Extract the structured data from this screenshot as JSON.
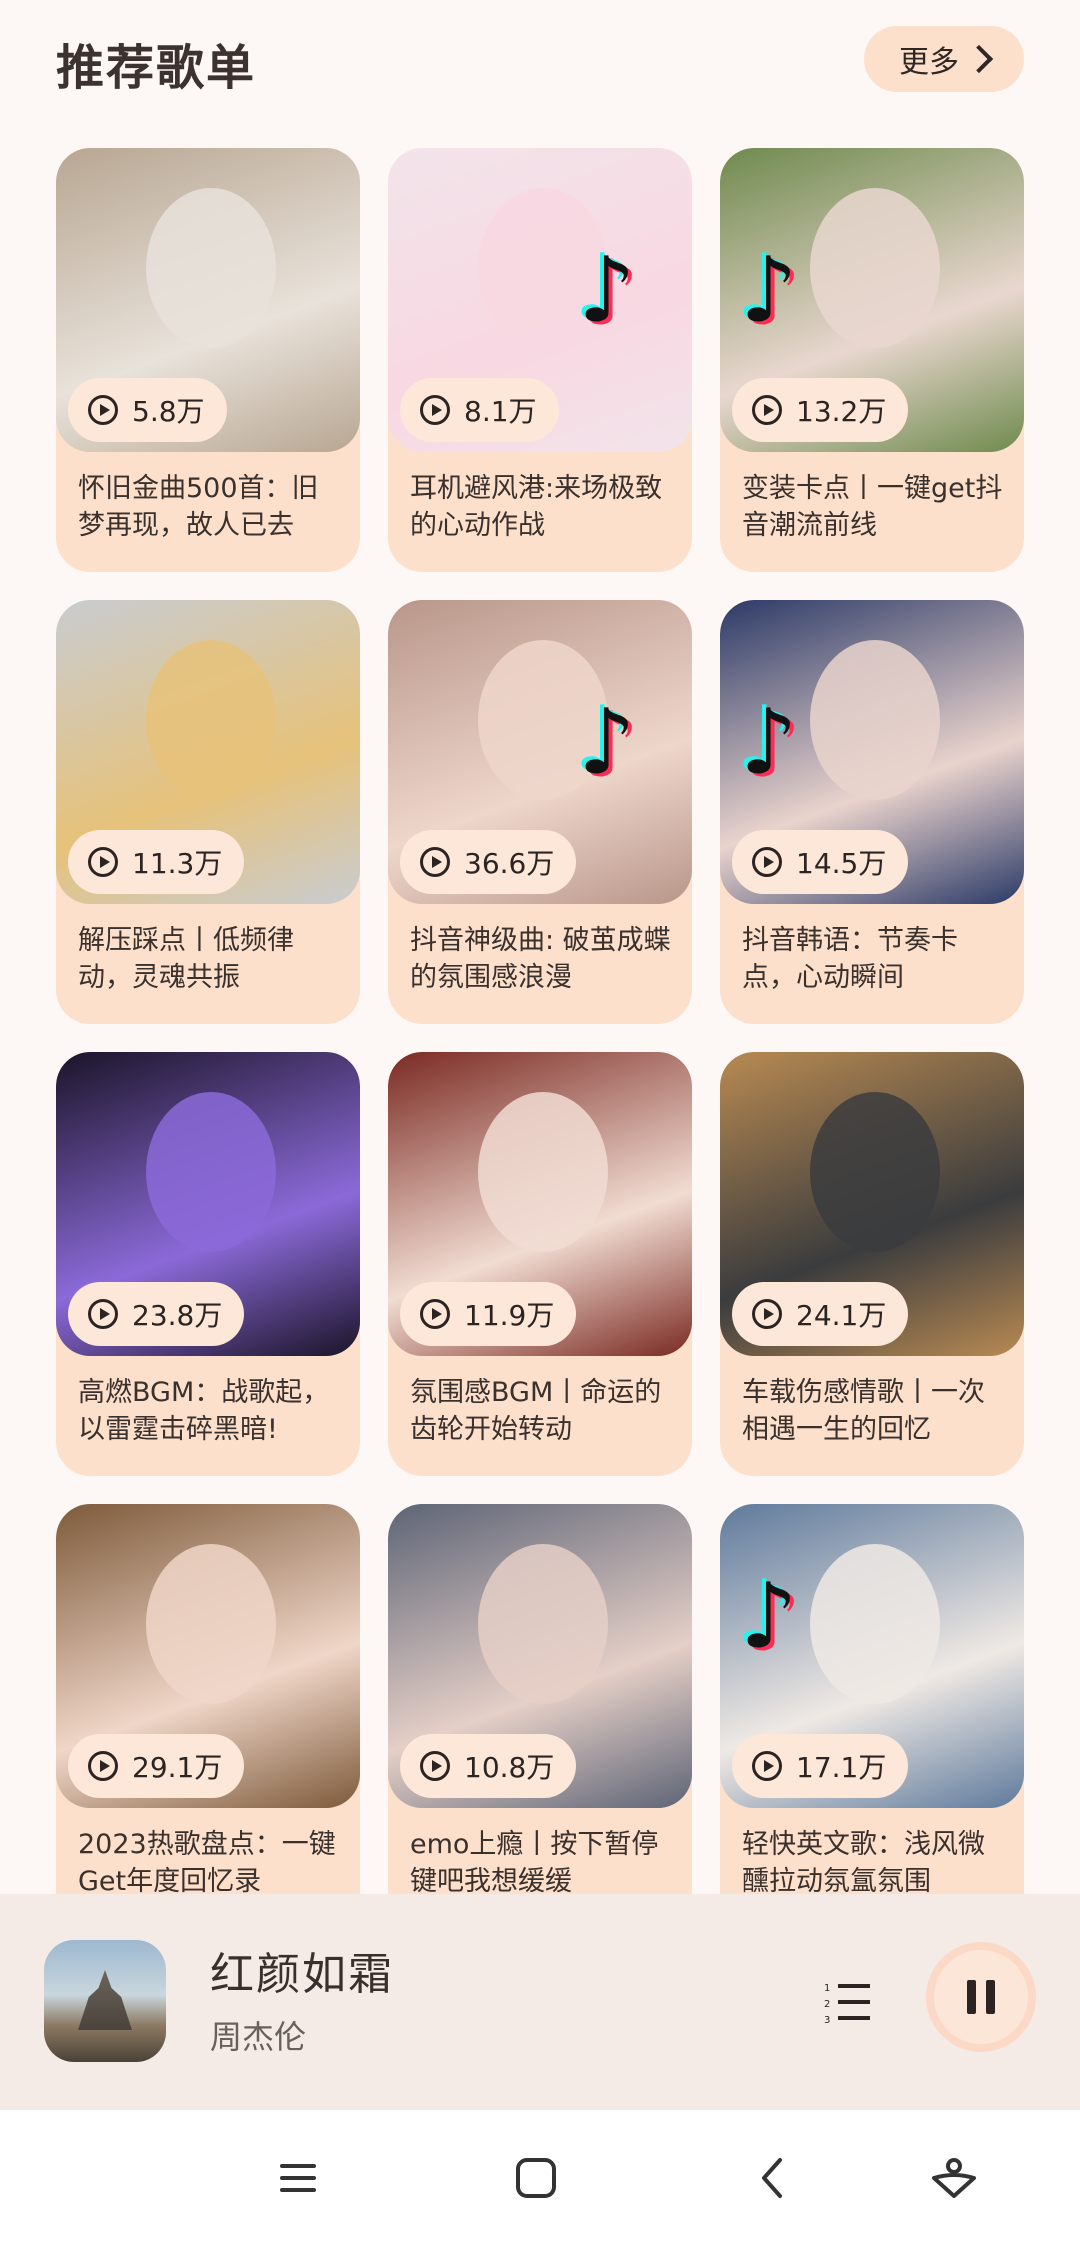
{
  "header": {
    "title": "推荐歌单",
    "more_label": "更多"
  },
  "playlists": [
    {
      "plays": "5.8万",
      "title": "怀旧金曲500首：旧梦再现，故人已去",
      "bg": "#b8a692",
      "accent": "#e8e2da"
    },
    {
      "plays": "8.1万",
      "title": "耳机避风港:来场极致的心动作战",
      "bg": "#f2e4ea",
      "accent": "#f8d8e2"
    },
    {
      "plays": "13.2万",
      "title": "变装卡点丨一键get抖音潮流前线",
      "bg": "#6f8a4e",
      "accent": "#e9d7cf"
    },
    {
      "plays": "11.3万",
      "title": "解压踩点丨低频律动，灵魂共振",
      "bg": "#c9ccd1",
      "accent": "#e6c27a"
    },
    {
      "plays": "36.6万",
      "title": "抖音神级曲: 破茧成蝶的氛围感浪漫",
      "bg": "#b9968a",
      "accent": "#eed6cb"
    },
    {
      "plays": "14.5万",
      "title": "抖音韩语：节奏卡点，心动瞬间",
      "bg": "#2c3a67",
      "accent": "#e9d3cd"
    },
    {
      "plays": "23.8万",
      "title": "高燃BGM：战歌起，以雷霆击碎黑暗!",
      "bg": "#1b1428",
      "accent": "#8b6ad8"
    },
    {
      "plays": "11.9万",
      "title": "氛围感BGM丨命运的齿轮开始转动",
      "bg": "#7a2a22",
      "accent": "#f1dcd2"
    },
    {
      "plays": "24.1万",
      "title": "车载伤感情歌丨一次相遇一生的回忆",
      "bg": "#b88a52",
      "accent": "#3b3c3e"
    },
    {
      "plays": "29.1万",
      "title": "2023热歌盘点：一键Get年度回忆录",
      "bg": "#7d5a3a",
      "accent": "#f0d6c8"
    },
    {
      "plays": "10.8万",
      "title": "emo上瘾丨按下暂停键吧我想缓缓",
      "bg": "#5d6476",
      "accent": "#e5cfc7"
    },
    {
      "plays": "17.1万",
      "title": "轻快英文歌：浅风微醺拉动氛氲氛围",
      "bg": "#5f7a9c",
      "accent": "#efe9e4"
    }
  ],
  "player": {
    "song": "红颜如霜",
    "artist": "周杰伦"
  },
  "colors": {
    "card": "#fde0cc",
    "page": "#fdf8f6",
    "player": "#f4ebe7"
  }
}
